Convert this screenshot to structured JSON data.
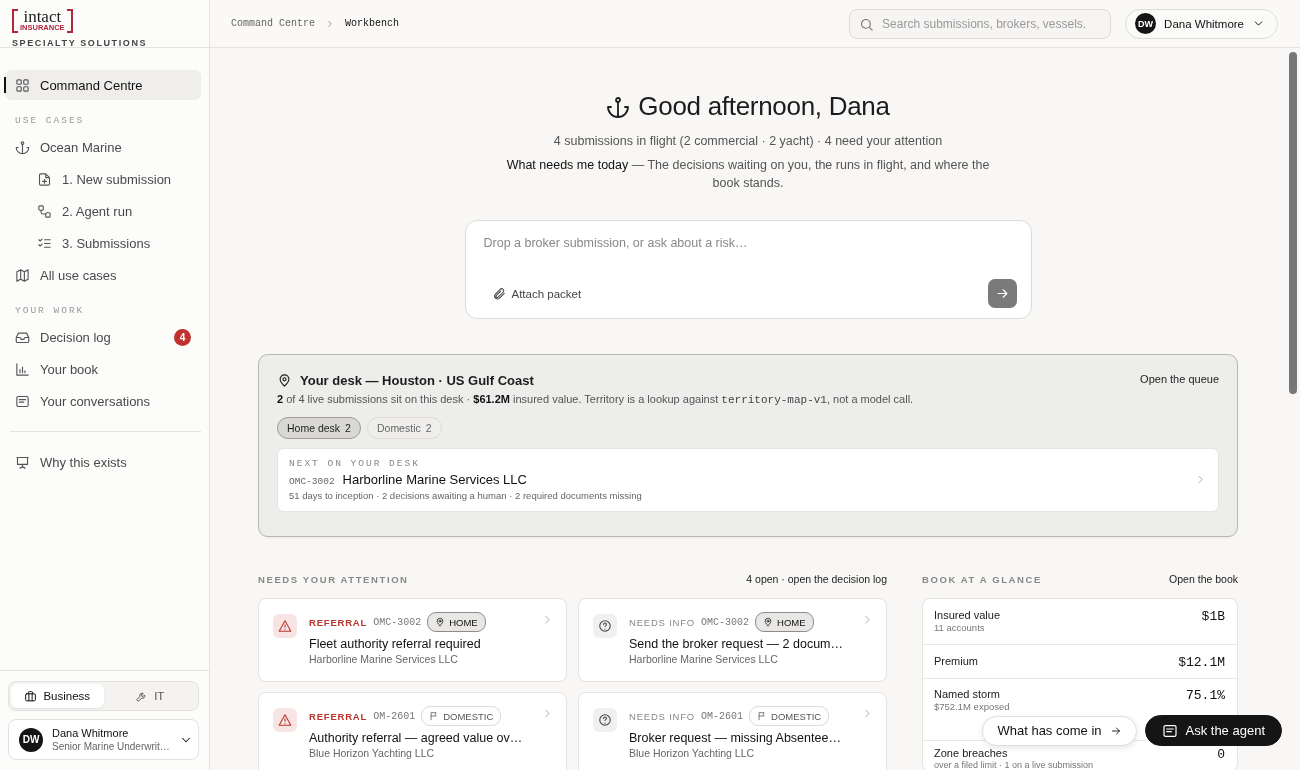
{
  "brand": {
    "wordmark": "intact",
    "wordmark_sub": "INSURANCE",
    "tagline": "SPECIALTY SOLUTIONS"
  },
  "sidebar": {
    "top": [
      {
        "label": "Command Centre",
        "selected": true
      }
    ],
    "sections": [
      {
        "heading": "USE CASES",
        "items": [
          {
            "label": "Ocean Marine",
            "selected": false,
            "children": [
              {
                "label": "1. New submission",
                "selected": false
              },
              {
                "label": "2. Agent run",
                "selected": false
              },
              {
                "label": "3. Submissions",
                "selected": false
              }
            ]
          },
          {
            "label": "All use cases",
            "selected": false
          }
        ]
      },
      {
        "heading": "YOUR WORK",
        "items": [
          {
            "label": "Decision log",
            "selected": false,
            "badge": "4"
          },
          {
            "label": "Your book",
            "selected": false
          },
          {
            "label": "Your conversations",
            "selected": false
          }
        ]
      }
    ],
    "footer_items": [
      {
        "label": "Why this exists",
        "selected": false
      }
    ],
    "modes": [
      {
        "label": "Business",
        "selected": true
      },
      {
        "label": "IT",
        "selected": false
      }
    ],
    "user": {
      "initials": "DW",
      "name": "Dana Whitmore",
      "role": "Senior Marine Underwrit…"
    }
  },
  "header": {
    "breadcrumb": [
      "Command Centre",
      "Workbench"
    ],
    "search": {
      "placeholder": "Search submissions, brokers, vessels."
    },
    "user": {
      "initials": "DW",
      "name": "Dana Whitmore"
    }
  },
  "hero": {
    "title": "Good afternoon, Dana",
    "summary": "4 submissions in flight (2 commercial · 2 yacht) · 4 need your attention",
    "intro": "**What needs me today** — The decisions waiting on you, the runs in flight, and where the book stands."
  },
  "composer": {
    "placeholder": "Drop a broker submission, or ask about a risk…",
    "attach": "Attach packet"
  },
  "desk": {
    "title": "Your desk — Houston · US Gulf Coast",
    "description": "**2** of 4 live submissions sit on this desk · **$61.2M** insured value. Territory is a lookup against",
    "code": "territory-map-v1",
    "description_end": ", not a model call.",
    "action": "Open the queue",
    "filters": [
      {
        "label": "Home desk",
        "count": "2",
        "selected": true
      },
      {
        "label": "Domestic",
        "count": "2",
        "selected": false
      }
    ],
    "next": {
      "eyebrow": "NEXT ON YOUR DESK",
      "id": "OMC-3002",
      "name": "Harborline Marine Services LLC",
      "meta": "51 days to inception · 2 decisions awaiting a human · 2 required documents missing"
    }
  },
  "attention": {
    "heading": "NEEDS YOUR ATTENTION",
    "action": "4 open · open the decision log",
    "items": [
      {
        "kind": "referral",
        "status": "REFERRAL",
        "id": "OMC-3002",
        "tag": {
          "kind": "home",
          "label": "HOME"
        },
        "title": "Fleet authority referral required",
        "subtitle": "Harborline Marine Services LLC"
      },
      {
        "kind": "info",
        "status": "NEEDS INFO",
        "id": "OMC-3002",
        "tag": {
          "kind": "home",
          "label": "HOME"
        },
        "title": "Send the broker request — 2 docum…",
        "subtitle": "Harborline Marine Services LLC"
      },
      {
        "kind": "referral",
        "status": "REFERRAL",
        "id": "OM-2601",
        "tag": {
          "kind": "domestic",
          "label": "DOMESTIC"
        },
        "title": "Authority referral — agreed value ov…",
        "subtitle": "Blue Horizon Yachting LLC"
      },
      {
        "kind": "info",
        "status": "NEEDS INFO",
        "id": "OM-2601",
        "tag": {
          "kind": "domestic",
          "label": "DOMESTIC"
        },
        "title": "Broker request — missing Absentee…",
        "subtitle": "Blue Horizon Yachting LLC"
      }
    ]
  },
  "book": {
    "heading": "BOOK AT A GLANCE",
    "action": "Open the book",
    "rows": [
      {
        "label": "Insured value",
        "sub": "11 accounts",
        "value": "$1B"
      },
      {
        "label": "Premium",
        "value": "$12.1M"
      },
      {
        "label": "Named storm",
        "sub": "$752.1M exposed",
        "value": "75.1%"
      },
      {
        "label": "Zone breaches",
        "sub": "over a filed limit · 1 on a live submission",
        "value": "0"
      }
    ]
  },
  "floating": [
    {
      "kind": "secondary",
      "label": "What has come in"
    },
    {
      "kind": "primary",
      "label": "Ask the agent"
    }
  ]
}
